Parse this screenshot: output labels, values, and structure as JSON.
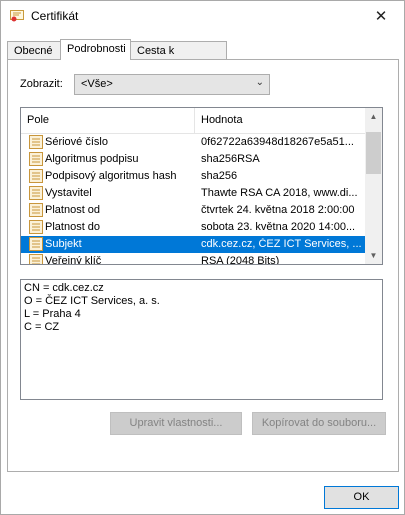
{
  "window": {
    "title": "Certifikát",
    "close_glyph": "✕"
  },
  "tabs": [
    {
      "label": "Obecné"
    },
    {
      "label": "Podrobnosti",
      "active": true
    },
    {
      "label": "Cesta k certifikátu"
    }
  ],
  "show": {
    "label": "Zobrazit:",
    "value": "<Vše>"
  },
  "list": {
    "columns": [
      "Pole",
      "Hodnota"
    ],
    "rows": [
      {
        "field": "Sériové číslo",
        "value": "0f62722a63948d18267e5a51..."
      },
      {
        "field": "Algoritmus podpisu",
        "value": "sha256RSA"
      },
      {
        "field": "Podpisový algoritmus hash",
        "value": "sha256"
      },
      {
        "field": "Vystavitel",
        "value": "Thawte RSA CA 2018, www.di..."
      },
      {
        "field": "Platnost od",
        "value": "čtvrtek 24. května 2018 2:00:00"
      },
      {
        "field": "Platnost do",
        "value": "sobota 23. května 2020 14:00..."
      },
      {
        "field": "Subjekt",
        "value": "cdk.cez.cz, ČEZ ICT Services, ...",
        "selected": true
      },
      {
        "field": "Veřejný klíč",
        "value": "RSA (2048 Bits)"
      }
    ]
  },
  "detail_text": "CN = cdk.cez.cz\nO = ČEZ ICT Services, a. s.\nL = Praha 4\nC = CZ",
  "buttons": {
    "edit_properties": "Upravit vlastnosti...",
    "copy_to_file": "Kopírovat do souboru...",
    "ok": "OK"
  },
  "colors": {
    "selection": "#0078d7",
    "disabled_btn": "#cccccc"
  }
}
